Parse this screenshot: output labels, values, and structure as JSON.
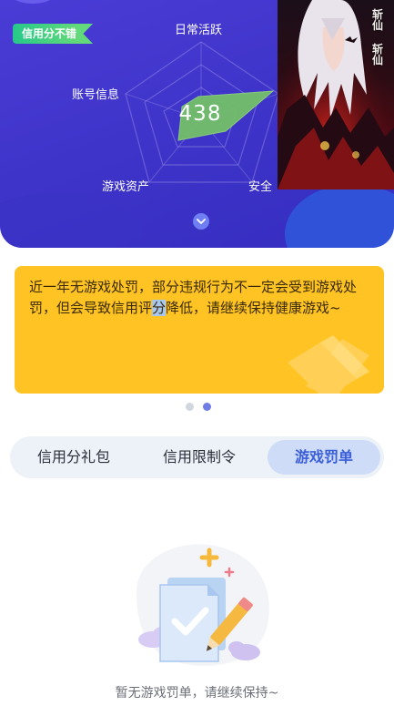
{
  "header": {
    "credit_badge": "信用分不错",
    "score": "438",
    "radar_labels": {
      "top": "日常活跃",
      "left": "账号信息",
      "bottom_left": "游戏资产",
      "bottom_right": "安全"
    },
    "expand_icon": "chevron-down-icon"
  },
  "poster": {
    "calligraphy": "斩仙"
  },
  "notice": {
    "text_before": "近一年无游戏处罚，部分违规行为不一定会受到游戏处罚，但会导致信用评",
    "text_highlight": "分",
    "text_after": "降低，请继续保持健康游戏~",
    "highlight_color": "#a7c7ee"
  },
  "carousel": {
    "total": 2,
    "active_index": 1
  },
  "tabs": [
    {
      "label": "信用分礼包",
      "active": false
    },
    {
      "label": "信用限制令",
      "active": false
    },
    {
      "label": "游戏罚单",
      "active": true
    }
  ],
  "empty_state": {
    "message": "暂无游戏罚单，请继续保持~",
    "illustration": "document-check-pencil-icon"
  },
  "colors": {
    "header_bg": "#3d33c8",
    "badge_green": "#27c88a",
    "notice_yellow": "#ffc424",
    "tab_active_bg": "#cfdcf8",
    "tab_active_text": "#3b5fd8"
  }
}
